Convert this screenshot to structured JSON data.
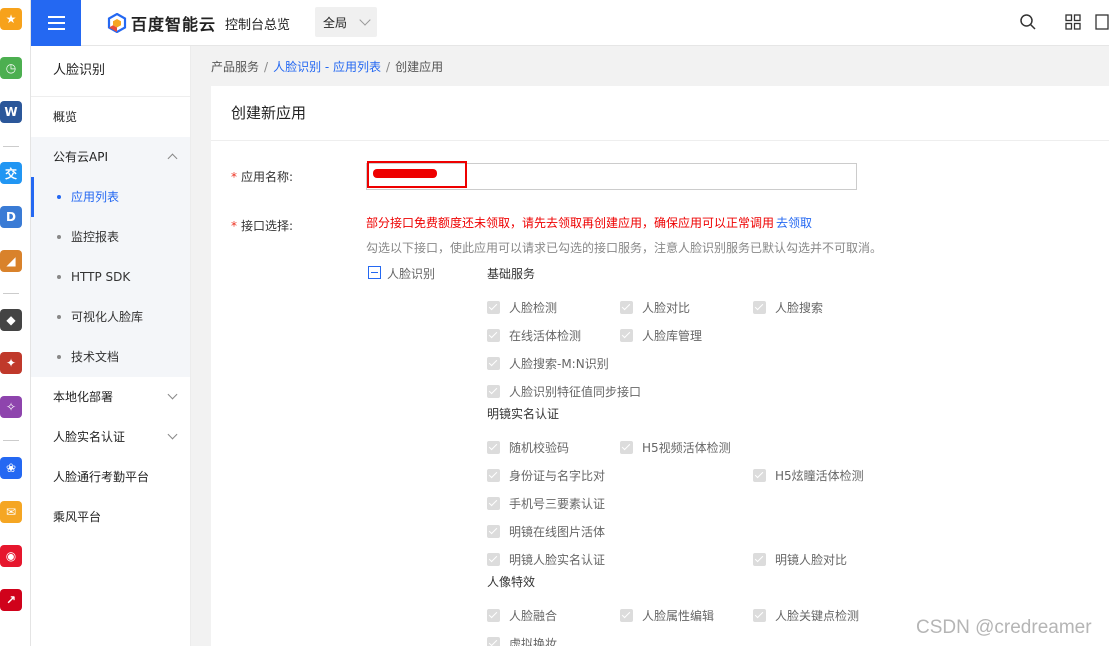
{
  "launcher": {
    "icons": [
      {
        "name": "star-app-icon",
        "color": "#f7a21b",
        "glyph": "★"
      },
      {
        "name": "clock-app-icon",
        "color": "#4caf50",
        "glyph": "◷"
      },
      {
        "name": "word-app-icon",
        "color": "#2b579a",
        "glyph": "W"
      },
      {
        "name": "chat-app-icon",
        "color": "#2196f3",
        "glyph": "交"
      },
      {
        "name": "d-app-icon",
        "color": "#3a7bd5",
        "glyph": "D"
      },
      {
        "name": "photo-app-icon",
        "color": "#d9822b",
        "glyph": "◢"
      },
      {
        "name": "game-app-icon-1",
        "color": "#444",
        "glyph": "◆"
      },
      {
        "name": "game-app-icon-2",
        "color": "#c0392b",
        "glyph": "✦"
      },
      {
        "name": "game-app-icon-3",
        "color": "#8e44ad",
        "glyph": "✧"
      },
      {
        "name": "baidu-app-icon",
        "color": "#2468f2",
        "glyph": "❀"
      },
      {
        "name": "mail-app-icon",
        "color": "#f5a623",
        "glyph": "✉"
      },
      {
        "name": "weibo-app-icon",
        "color": "#e6162d",
        "glyph": "◉"
      },
      {
        "name": "chart-app-icon",
        "color": "#d0021b",
        "glyph": "↗"
      }
    ]
  },
  "topbar": {
    "brand": "百度智能云",
    "console": "控制台总览",
    "region": "全局"
  },
  "sidebar": {
    "title": "人脸识别",
    "overview": "概览",
    "public_api": "公有云API",
    "sub_items": [
      "应用列表",
      "监控报表",
      "HTTP SDK",
      "可视化人脸库",
      "技术文档"
    ],
    "local_deploy": "本地化部署",
    "realname": "人脸实名认证",
    "attendance": "人脸通行考勤平台",
    "chengfeng": "乘风平台"
  },
  "breadcrumb": {
    "root": "产品服务",
    "parent": "人脸识别 - 应用列表",
    "current": "创建应用"
  },
  "form": {
    "title": "创建新应用",
    "name_label": "应用名称:",
    "api_label": "接口选择:",
    "warning": "部分接口免费额度还未领取，请先去领取再创建应用，确保应用可以正常调用",
    "warning_link": "去领取",
    "hint": "勾选以下接口，使此应用可以请求已勾选的接口服务，注意人脸识别服务已默认勾选并不可取消。",
    "tree_label": "人脸识别",
    "sections": {
      "basic": "基础服务",
      "mingjing": "明镜实名认证",
      "portrait": "人像特效"
    },
    "apis": {
      "face_detect": "人脸检测",
      "face_compare": "人脸对比",
      "face_search": "人脸搜索",
      "online_liveness": "在线活体检测",
      "face_lib": "人脸库管理",
      "face_search_mn": "人脸搜索-M:N识别",
      "feature_sync": "人脸识别特征值同步接口",
      "random_code": "随机校验码",
      "h5_video_liveness": "H5视频活体检测",
      "id_name_compare": "身份证与名字比对",
      "h5_flash_liveness": "H5炫瞳活体检测",
      "phone_three": "手机号三要素认证",
      "mingjing_online_photo": "明镜在线图片活体",
      "mingjing_realname": "明镜人脸实名认证",
      "mingjing_compare": "明镜人脸对比",
      "face_merge": "人脸融合",
      "attr_edit": "人脸属性编辑",
      "keypoint": "人脸关键点检测",
      "virtual_makeup": "虚拟换妆"
    }
  },
  "watermark": "CSDN @credreamer",
  "colors": {
    "accent": "#2468f2",
    "warning": "#e00000"
  }
}
